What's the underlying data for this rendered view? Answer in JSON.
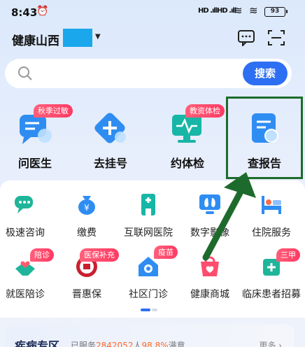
{
  "status_bar": {
    "time": "8:43",
    "signal1": "HD .ıll",
    "signal2": "HD .ıll",
    "battery": "93"
  },
  "header": {
    "title": "健康山西"
  },
  "search": {
    "placeholder": "",
    "button_label": "搜索"
  },
  "quick_actions": [
    {
      "label": "问医生",
      "tag": "秋季过敏",
      "icon": "chat-doctor-icon"
    },
    {
      "label": "去挂号",
      "tag": "",
      "icon": "plus-register-icon"
    },
    {
      "label": "约体检",
      "tag": "教资体检",
      "icon": "monitor-checkup-icon"
    },
    {
      "label": "查报告",
      "tag": "",
      "icon": "report-search-icon"
    }
  ],
  "services_row1": [
    {
      "label": "极速咨询",
      "icon": "chat-bubbles-icon"
    },
    {
      "label": "缴费",
      "icon": "money-bag-icon"
    },
    {
      "label": "互联网医院",
      "icon": "hospital-building-icon"
    },
    {
      "label": "数字影像",
      "icon": "lungs-monitor-icon"
    },
    {
      "label": "住院服务",
      "icon": "hospital-bed-icon"
    }
  ],
  "services_row2": [
    {
      "label": "就医陪诊",
      "tag": "陪诊",
      "icon": "handshake-heart-icon"
    },
    {
      "label": "晋惠保",
      "tag": "医保补充",
      "icon": "jinhuibao-logo-icon"
    },
    {
      "label": "社区门诊",
      "tag": "疫苗",
      "icon": "home-clinic-icon"
    },
    {
      "label": "健康商城",
      "tag": "",
      "icon": "shopping-bag-icon"
    },
    {
      "label": "临床患者招募",
      "tag": "三甲",
      "icon": "clinical-recruit-icon"
    }
  ],
  "bottom_card": {
    "title": "疾病专区",
    "desc_prefix": "已服务",
    "served_count": "2842052",
    "desc_mid": "人",
    "satisfaction": "98.8%",
    "desc_suffix": "满意",
    "more": "更多"
  },
  "colors": {
    "accent": "#2d6ff2",
    "tag": "#ff3a63",
    "highlight": "#1d6b2c"
  }
}
